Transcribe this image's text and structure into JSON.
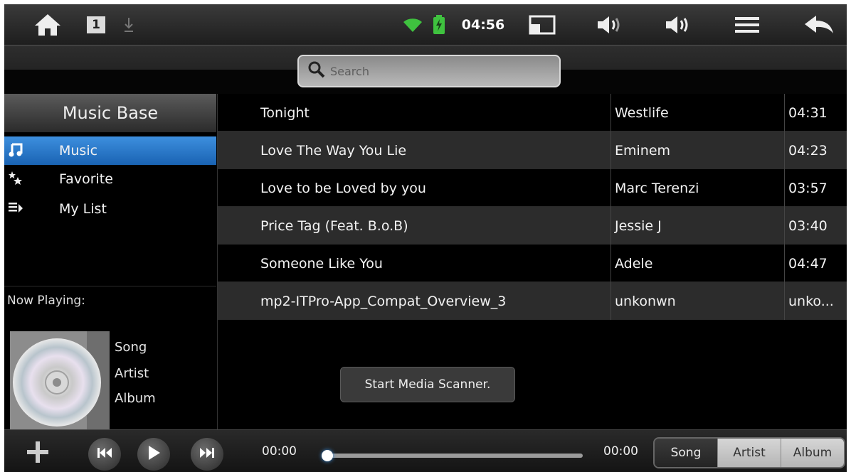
{
  "status_bar": {
    "clock": "04:56",
    "notification_count": "1"
  },
  "search": {
    "placeholder": "Search",
    "value": ""
  },
  "sidebar": {
    "title": "Music Base",
    "items": [
      {
        "label": "Music",
        "icon": "music-note-icon",
        "active": true
      },
      {
        "label": "Favorite",
        "icon": "stars-icon",
        "active": false
      },
      {
        "label": "My List",
        "icon": "playlist-icon",
        "active": false
      }
    ],
    "now_playing_label": "Now Playing:",
    "now_playing": {
      "song": "Song",
      "artist": "Artist",
      "album": "Album"
    }
  },
  "songs": [
    {
      "title": "Tonight",
      "artist": "Westlife",
      "duration": "04:31"
    },
    {
      "title": "Love The Way You Lie",
      "artist": "Eminem",
      "duration": "04:23"
    },
    {
      "title": "Love to be Loved by you",
      "artist": "Marc Terenzi",
      "duration": "03:57"
    },
    {
      "title": "Price Tag (Feat. B.o.B)",
      "artist": "Jessie J",
      "duration": "03:40"
    },
    {
      "title": "Someone Like You",
      "artist": "Adele",
      "duration": "04:47"
    },
    {
      "title": "mp2-ITPro-App_Compat_Overview_3",
      "artist": "unkonwn",
      "duration": "unko..."
    }
  ],
  "toast": "Start Media Scanner.",
  "player": {
    "elapsed": "00:00",
    "total": "00:00",
    "progress": 0.02
  },
  "view_tabs": [
    {
      "label": "Song",
      "active": true
    },
    {
      "label": "Artist",
      "active": false
    },
    {
      "label": "Album",
      "active": false
    }
  ],
  "colors": {
    "accent": "#3d8fde",
    "background": "#000000",
    "row_alt": "#2c2c2c"
  }
}
